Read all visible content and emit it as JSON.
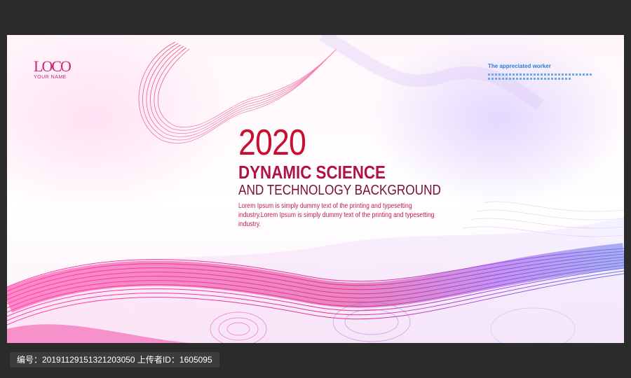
{
  "poster": {
    "logo_mark": "LOCO",
    "logo_sub": "YOUR NAME",
    "tagline": "The appreciated worker",
    "year": "2020",
    "title_line1": "DYNAMIC SCIENCE",
    "title_line2": "AND TECHNOLOGY BACKGROUND",
    "body": "Lorem Ipsum is simply dummy text of the printing and typesetting industry.Lorem Ipsum is simply dummy text of the printing and typesetting industry."
  },
  "footer": {
    "text": "编号：20191129151321203050 上传者ID：1605095"
  },
  "colors": {
    "frame": "#2b2b2b",
    "accent_red": "#c8102e",
    "accent_pink": "#e0338f",
    "accent_purple": "#8a4fe0",
    "tagline_blue": "#2a7fd6"
  }
}
